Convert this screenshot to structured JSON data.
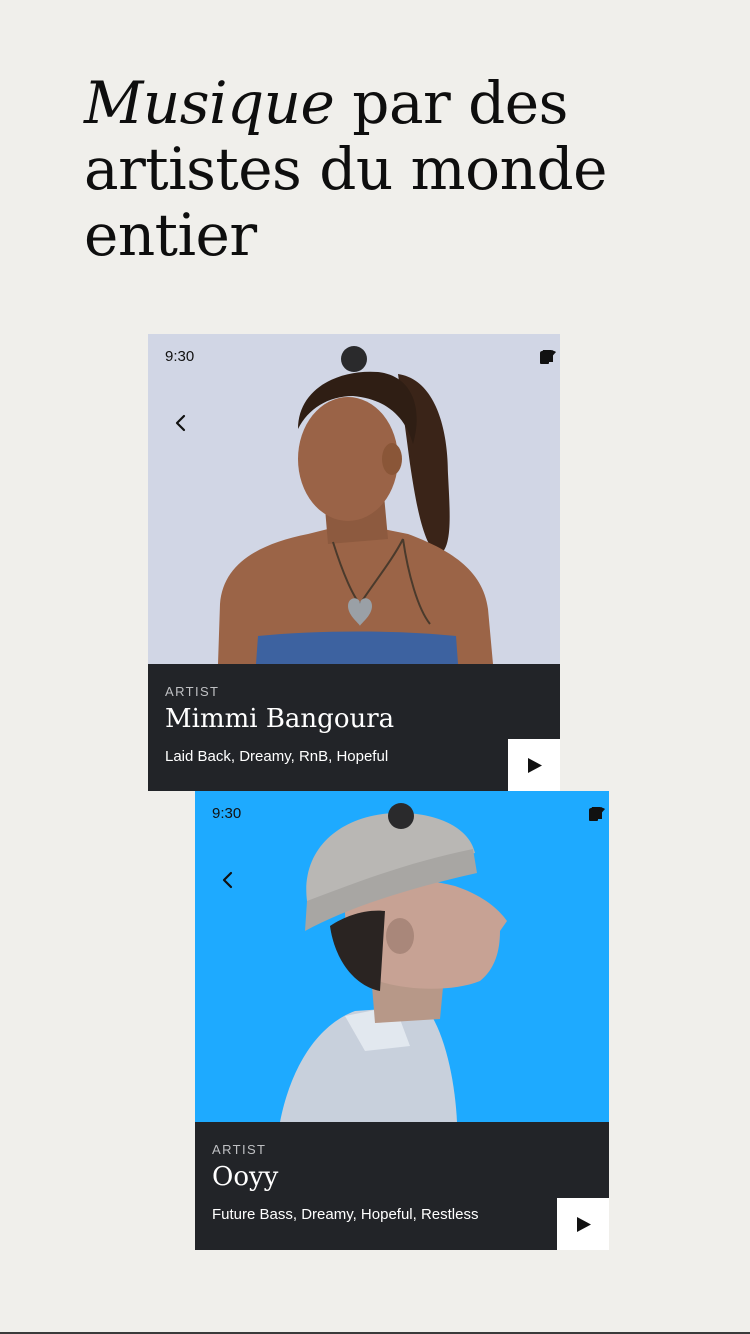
{
  "headline": {
    "italic": "Musique",
    "rest": " par des artistes du monde entier"
  },
  "cards": [
    {
      "time": "9:30",
      "label": "ARTIST",
      "name": "Mimmi Bangoura",
      "tags": "Laid Back, Dreamy, RnB, Hopeful",
      "background": "#d1d6e5"
    },
    {
      "time": "9:30",
      "label": "ARTIST",
      "name": "Ooyy",
      "tags": "Future Bass, Dreamy, Hopeful, Restless",
      "background": "#1eaaff"
    }
  ],
  "colors": {
    "page_bg": "#f0efeb",
    "panel_bg": "#222428",
    "play_bg": "#ffffff"
  },
  "icons": [
    "wifi-icon",
    "signal-icon",
    "battery-icon",
    "back-arrow-icon",
    "play-icon"
  ]
}
